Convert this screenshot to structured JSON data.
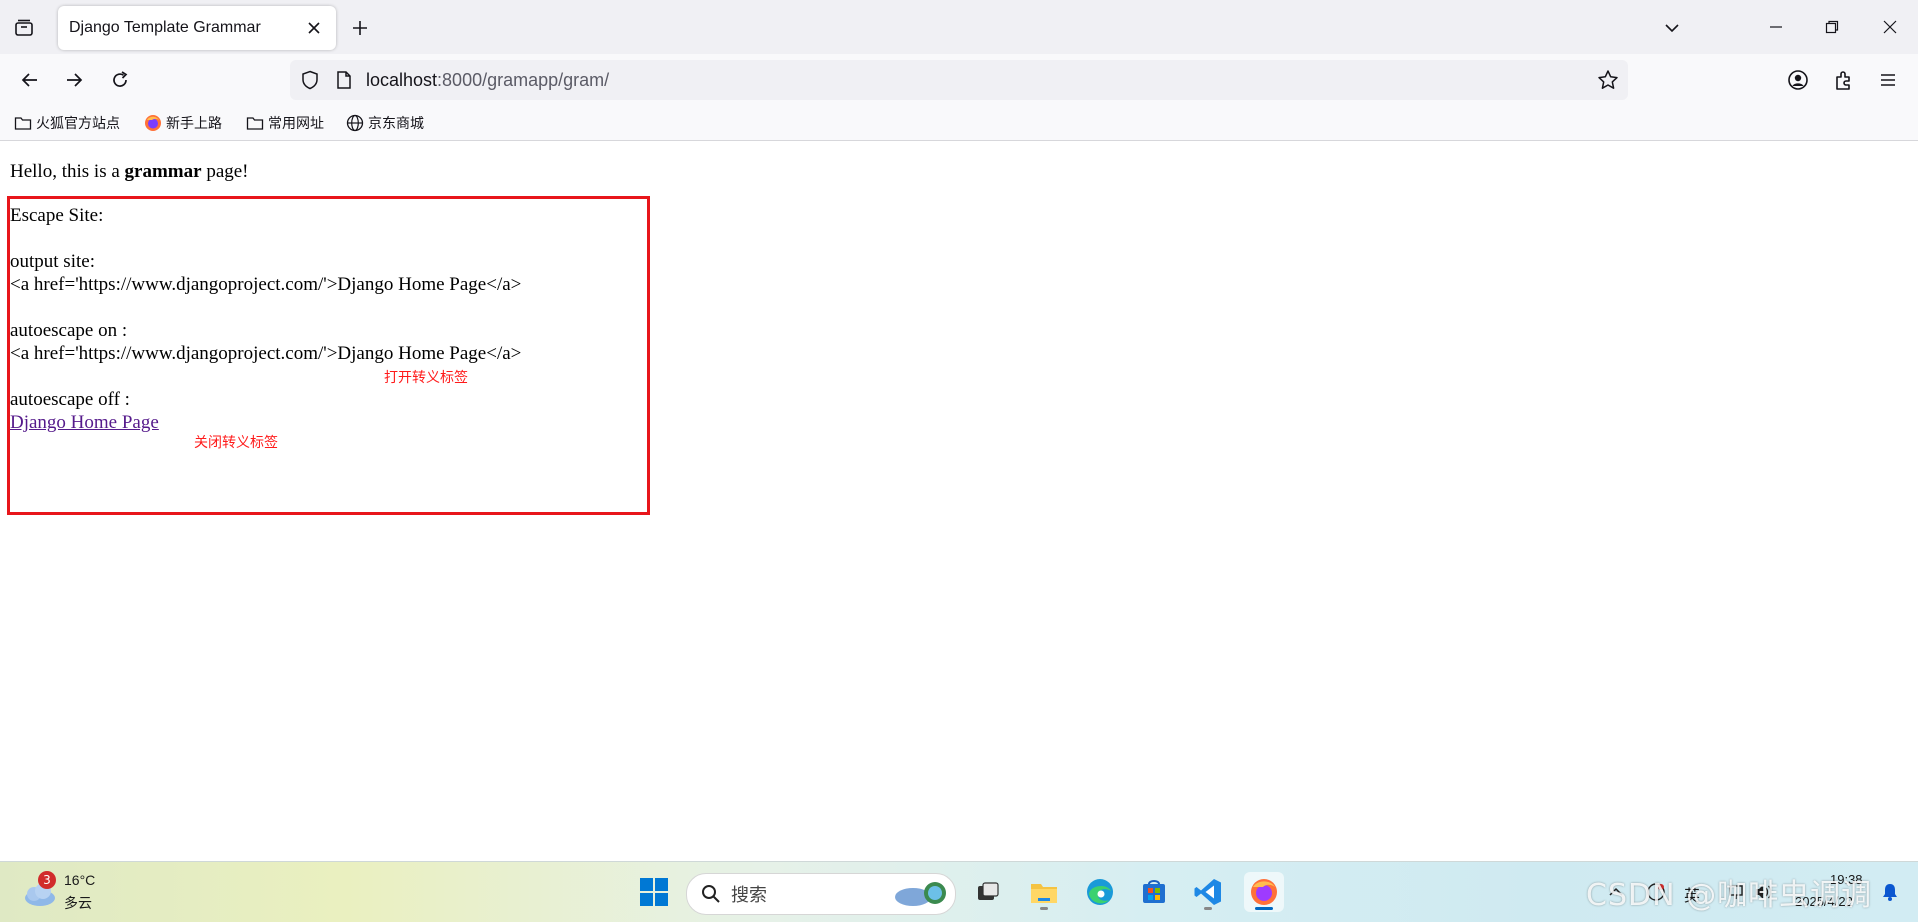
{
  "browser": {
    "tab_title": "Django Template Grammar",
    "url_host": "localhost",
    "url_rest": ":8000/gramapp/gram/"
  },
  "bookmarks": [
    {
      "label": "火狐官方站点",
      "icon": "folder-icon"
    },
    {
      "label": "新手上路",
      "icon": "firefox-icon"
    },
    {
      "label": "常用网址",
      "icon": "folder-icon"
    },
    {
      "label": "京东商城",
      "icon": "globe-icon"
    }
  ],
  "page": {
    "hello_prefix": "Hello, this is a ",
    "hello_bold": "grammar",
    "hello_suffix": " page!",
    "escape_site": "Escape Site:",
    "output_label": "output site:",
    "output_value": "<a href='https://www.djangoproject.com/'>Django Home Page</a>",
    "autoescape_on_label": "autoescape on :",
    "autoescape_on_value": "<a href='https://www.djangoproject.com/'>Django Home Page</a>",
    "autoescape_off_label": "autoescape off :",
    "link_text": "Django Home Page"
  },
  "annotations": {
    "open_escape": "打开转义标签",
    "close_escape": "关闭转义标签"
  },
  "taskbar": {
    "weather_temp": "16°C",
    "weather_desc": "多云",
    "weather_badge": "3",
    "search_placeholder": "搜索",
    "ime": "英",
    "clock_time": "19:38",
    "clock_date": "2025/4/22",
    "watermark": "CSDN @咖啡虫调调"
  },
  "colors": {
    "annotation_red": "#e8161b",
    "visited_link": "#551a8b",
    "accent_blue": "#0067c0"
  }
}
